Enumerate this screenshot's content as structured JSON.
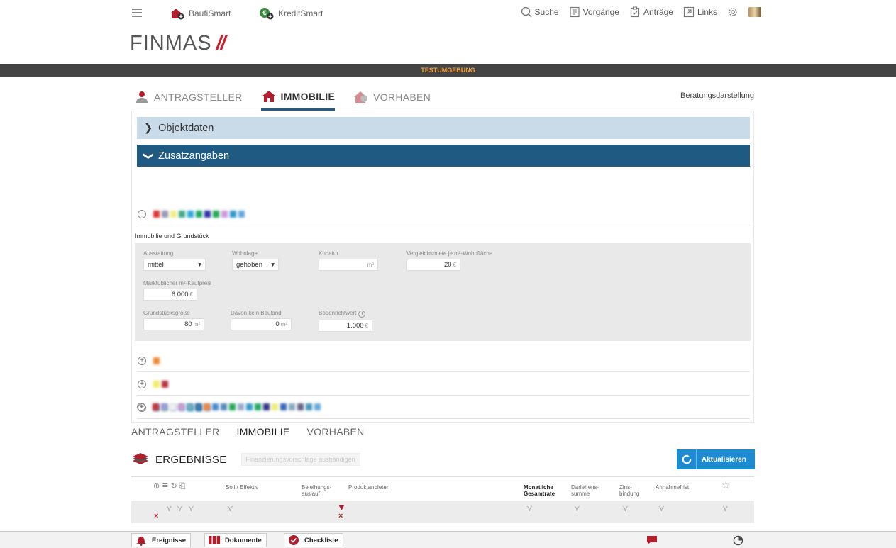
{
  "header": {
    "brand_links": [
      {
        "label": "BaufiSmart"
      },
      {
        "label": "KreditSmart"
      }
    ],
    "logo": "FINMAS",
    "nav": [
      {
        "label": "Suche"
      },
      {
        "label": "Vorgänge"
      },
      {
        "label": "Anträge"
      },
      {
        "label": "Links"
      }
    ]
  },
  "env_banner": "TESTUMGEBUNG",
  "tabs": [
    {
      "label": "ANTRAGSTELLER"
    },
    {
      "label": "IMMOBILIE"
    },
    {
      "label": "VORHABEN"
    }
  ],
  "beratungsdarstellung": "Beratungsdarstellung",
  "accordion": {
    "objektdaten": "Objektdaten",
    "zusatzangaben": "Zusatzangaben"
  },
  "section_title": "Immobilie und Grundstück",
  "form": {
    "ausstattung": {
      "label": "Ausstattung",
      "value": "mittel"
    },
    "wohnlage": {
      "label": "Wohnlage",
      "value": "gehoben"
    },
    "kubatur": {
      "label": "Kubatur",
      "value": "",
      "unit": "m³"
    },
    "vergleichsmiete": {
      "label": "Vergleichsmiete je m²-Wohnfläche",
      "value": "20",
      "unit": "€"
    },
    "kaufpreis": {
      "label": "Marktüblicher m²-Kaufpreis",
      "value": "6.000",
      "unit": "€"
    },
    "grundstueck": {
      "label": "Grundstücksgröße",
      "value": "80",
      "unit": "m²"
    },
    "kein_bauland": {
      "label": "Davon kein Bauland",
      "value": "0",
      "unit": "m²"
    },
    "bodenrichtwert": {
      "label": "Bodenrichtwert",
      "value": "1.000",
      "unit": "€"
    }
  },
  "tabs_bottom": [
    {
      "label": "ANTRAGSTELLER"
    },
    {
      "label": "IMMOBILIE"
    },
    {
      "label": "VORHABEN"
    }
  ],
  "results": {
    "title": "ERGEBNISSE",
    "handout_button": "Finanzierungsvorschläge aushändigen",
    "refresh_button": "Aktualisieren",
    "columns": {
      "soll": "Soll / Effektiv",
      "beleihung": [
        "Beleihungs-",
        "auslauf"
      ],
      "produkt": "Produktanbieter",
      "monatlich": [
        "Monatliche",
        "Gesamtrate"
      ],
      "darlehen": [
        "Darlehens-",
        "summe"
      ],
      "zins": [
        "Zins-",
        "bindung"
      ],
      "annahme": "Annahmefrist"
    }
  },
  "bottom_bar": [
    {
      "label": "Ereignisse"
    },
    {
      "label": "Dokumente"
    },
    {
      "label": "Checkliste"
    }
  ],
  "colors": {
    "accent_dark": "#1f5a82",
    "accent_light": "#c9dbe9",
    "brand_red": "#c8202f",
    "button_blue": "#1e8ad0",
    "env_text": "#f0a040"
  }
}
